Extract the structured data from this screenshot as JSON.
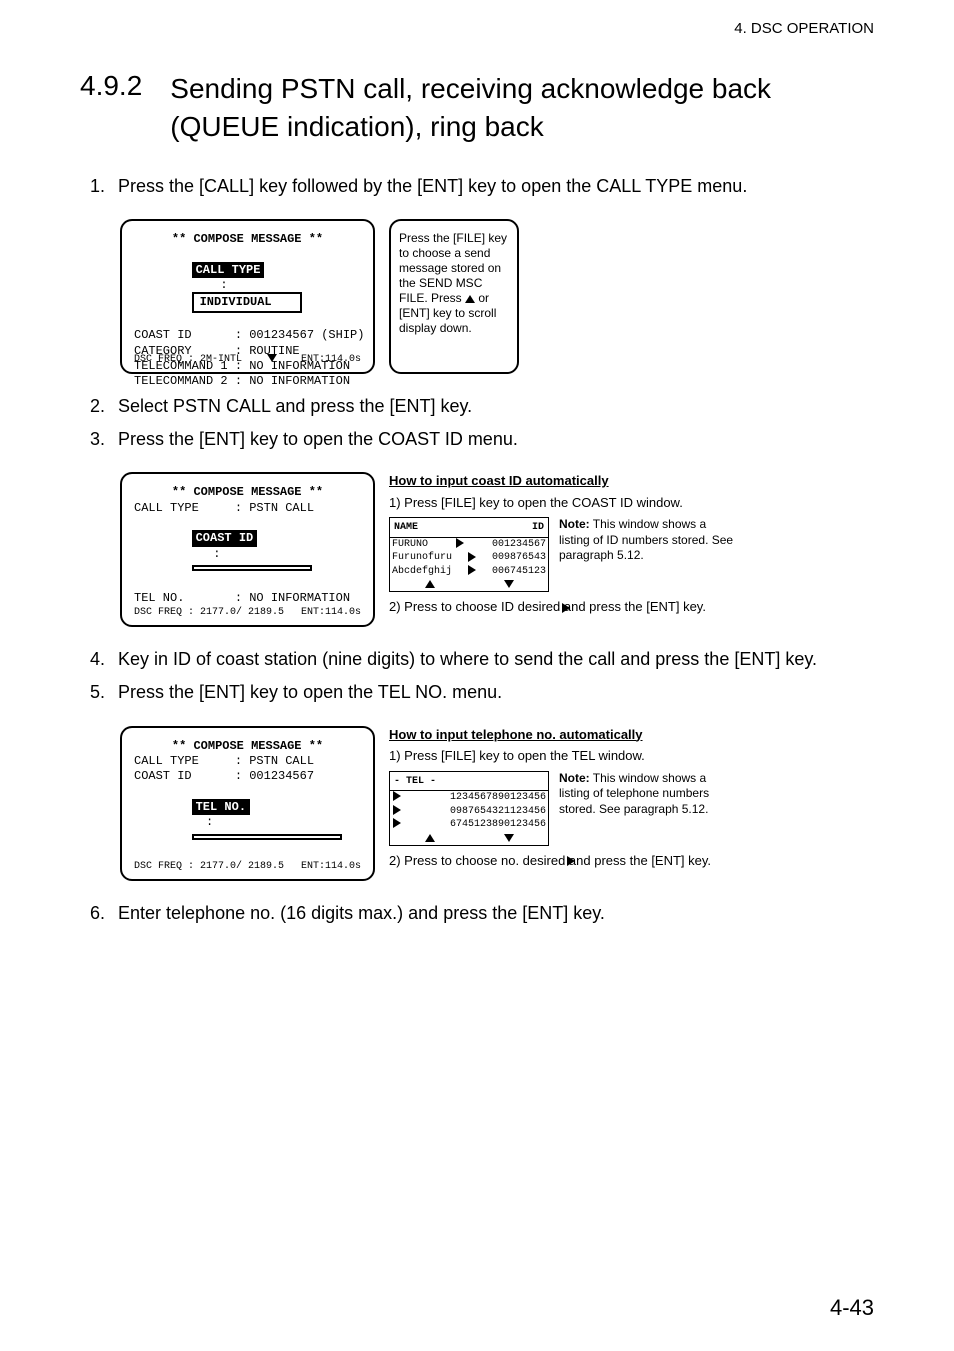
{
  "running_header": "4. DSC OPERATION",
  "heading": {
    "number": "4.9.2",
    "title": "Sending PSTN call, receiving acknowledge back (QUEUE indication), ring back"
  },
  "steps": {
    "s1": {
      "n": "1.",
      "t": "Press the [CALL] key followed by the [ENT] key to open the CALL TYPE menu."
    },
    "s2": {
      "n": "2.",
      "t": "Select PSTN CALL and press the [ENT] key."
    },
    "s3": {
      "n": "3.",
      "t": "Press the [ENT] key to open the COAST ID menu."
    },
    "s4": {
      "n": "4.",
      "t": "Key in ID of coast station (nine digits) to where to send the call and press the [ENT] key."
    },
    "s5": {
      "n": "5.",
      "t": "Press the [ENT] key to open the TEL NO. menu."
    },
    "s6": {
      "n": "6.",
      "t": "Enter telephone no. (16 digits max.) and press the [ENT] key."
    }
  },
  "lcd1": {
    "title": "** COMPOSE MESSAGE **",
    "label": "CALL TYPE",
    "value": "INDIVIDUAL",
    "l2": "COAST ID      : 001234567 (SHIP)",
    "l3": "CATEGORY      : ROUTINE",
    "l4": "TELECOMMAND 1 : NO INFORMATION",
    "l5": "TELECOMMAND 2 : NO INFORMATION",
    "status_left": "DSC FREQ      : 2M-INTL",
    "status_right": "ENT:114.0s"
  },
  "callout1": {
    "t1": "Press the [FILE] key to choose a send message stored on the SEND MSC FILE. Press",
    "t2": " or [ENT] key to scroll display down."
  },
  "lcd2": {
    "title": "** COMPOSE MESSAGE **",
    "l1": "CALL TYPE     : PSTN CALL",
    "label": "COAST ID",
    "value": "",
    "l3": "TEL NO.       : NO INFORMATION",
    "status_left": "DSC FREQ      :  2177.0/ 2189.5",
    "status_right": "ENT:114.0s"
  },
  "howto_coast": {
    "title": "How to input coast ID automatically",
    "p1": "1) Press [FILE] key to open the COAST ID window.",
    "lcd": {
      "hdr_l": "NAME",
      "hdr_r": "ID",
      "r1l": "FURUNO",
      "r1r": "001234567",
      "r2l": "Furunofuru",
      "r2r": "009876543",
      "r3l": "Abcdefghij",
      "r3r": "006745123"
    },
    "note_label": "Note:",
    "note_text": " This window shows a listing of ID numbers stored. See paragraph 5.12.",
    "p2": "2) Press     to choose ID desired and press the [ENT] key."
  },
  "lcd3": {
    "title": "** COMPOSE MESSAGE **",
    "l1": "CALL TYPE     : PSTN CALL",
    "l2": "COAST ID      : 001234567",
    "label": "TEL NO.",
    "value": "",
    "status_left": "DSC FREQ      :  2177.0/ 2189.5",
    "status_right": "ENT:114.0s"
  },
  "howto_tel": {
    "title": "How to input telephone no.  automatically",
    "p1": "1) Press [FILE] key to open the TEL window.",
    "lcd": {
      "hdr_l": "- TEL -",
      "hdr_r": "",
      "r1l": "",
      "r1r": "1234567890123456",
      "r2l": "",
      "r2r": "0987654321123456",
      "r3l": "",
      "r3r": "6745123890123456"
    },
    "note_label": "Note:",
    "note_text": " This window shows a listing of telephone numbers stored. See paragraph 5.12.",
    "p2": "2) Press     to choose no. desired and press the [ENT] key."
  },
  "page_number": "4-43"
}
